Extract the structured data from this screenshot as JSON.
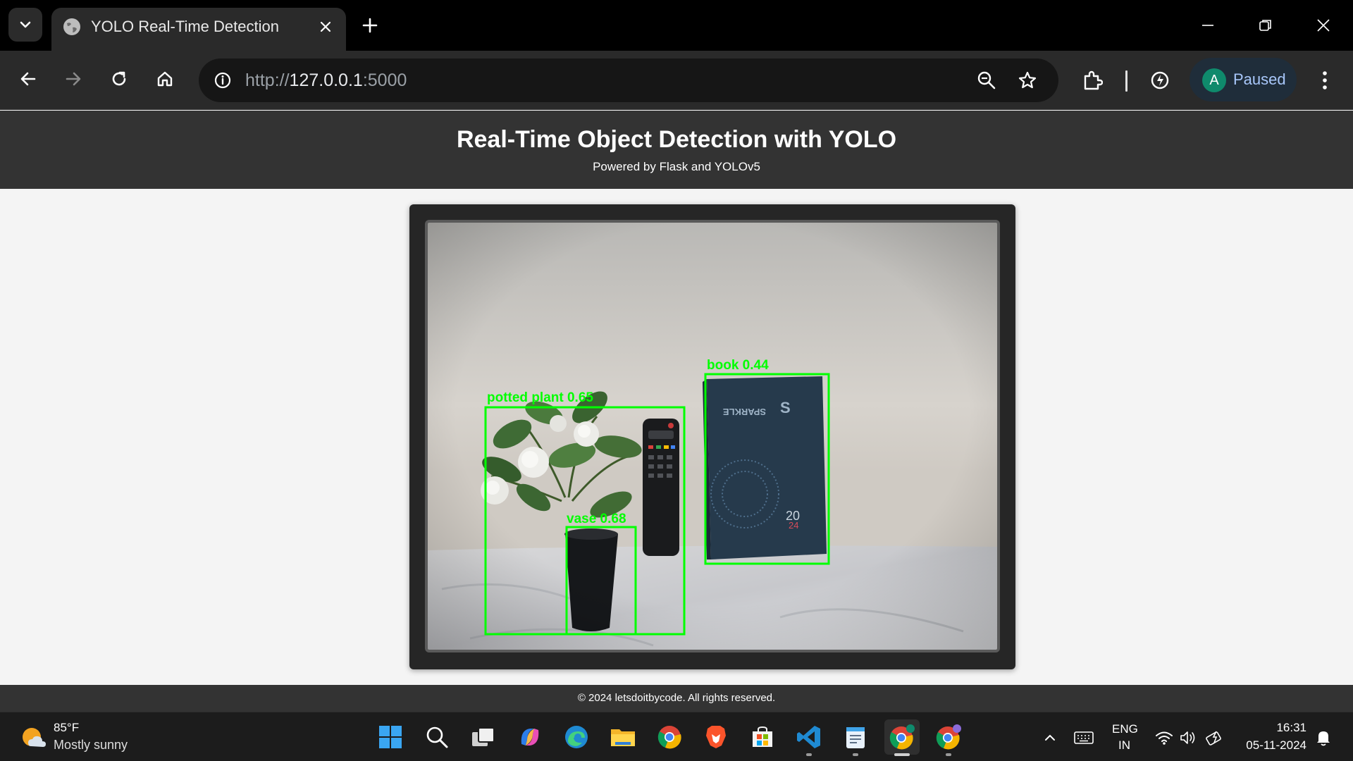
{
  "browser": {
    "tab": {
      "title": "YOLO Real-Time Detection"
    },
    "url": {
      "scheme": "http://",
      "host": "127.0.0.1",
      "port": ":5000"
    },
    "profile": {
      "initial": "A",
      "status": "Paused"
    }
  },
  "page": {
    "header": {
      "title": "Real-Time Object Detection with YOLO",
      "subtitle": "Powered by Flask and YOLOv5"
    },
    "detections": [
      {
        "label": "potted plant 0.65"
      },
      {
        "label": "vase 0.68"
      },
      {
        "label": "book 0.44"
      }
    ],
    "detection_color": "#00ff00",
    "footer": {
      "text": "© 2024 letsdoitbycode. All rights reserved."
    }
  },
  "taskbar": {
    "weather": {
      "temp": "85°F",
      "desc": "Mostly sunny"
    },
    "apps": [
      "start-icon",
      "search-icon",
      "task-view-icon",
      "copilot-icon",
      "edge-icon",
      "file-explorer-icon",
      "chrome-icon",
      "brave-icon",
      "store-icon",
      "vscode-icon",
      "notepad-icon",
      "chrome-profile-icon",
      "chrome-profile-2-icon"
    ],
    "language": {
      "line1": "ENG",
      "line2": "IN"
    },
    "clock": {
      "time": "16:31",
      "date": "05-11-2024"
    }
  }
}
